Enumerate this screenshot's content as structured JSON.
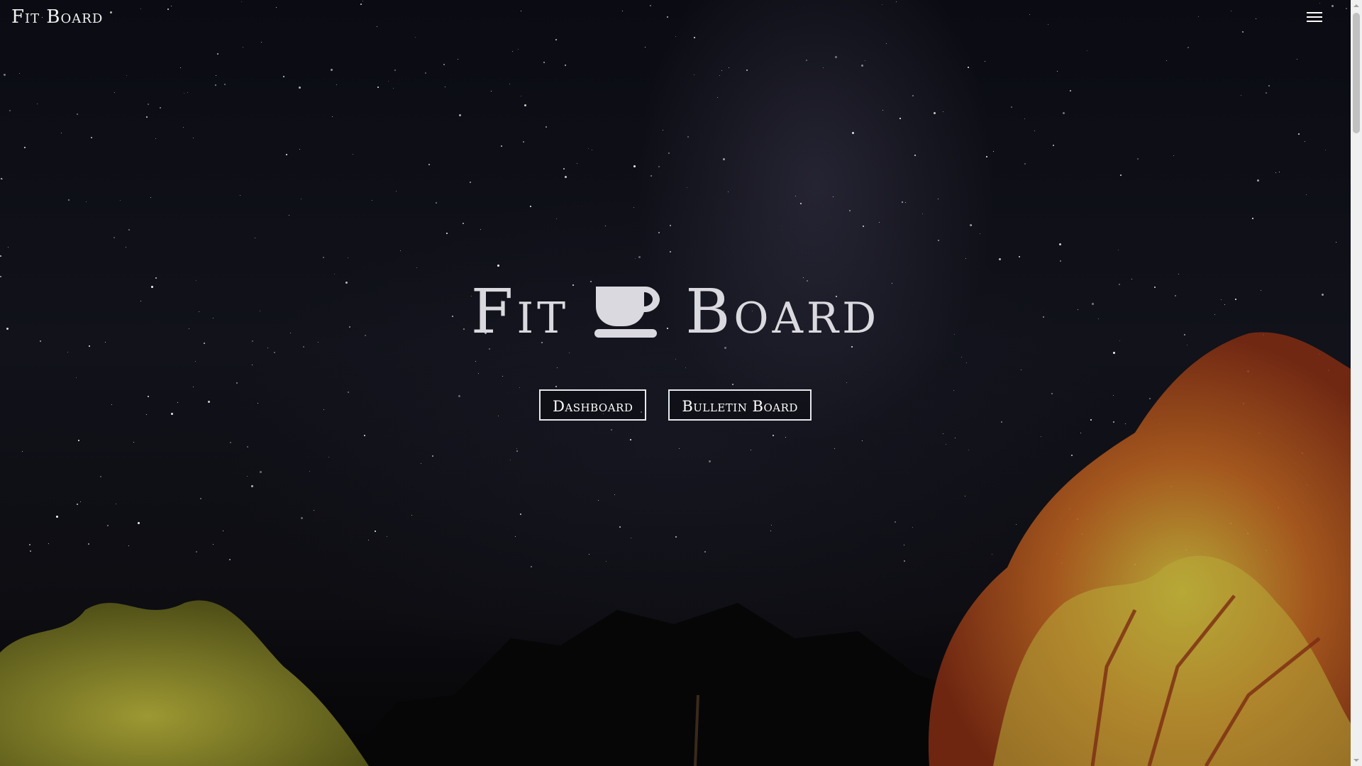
{
  "navbar": {
    "brand": "Fit Board",
    "menu_icon": "hamburger-menu-icon"
  },
  "hero": {
    "title_left": "Fit",
    "title_icon": "coffee-cup-icon",
    "title_right": "Board",
    "buttons": [
      {
        "label": "Dashboard"
      },
      {
        "label": "Bulletin Board"
      }
    ]
  },
  "scrollbar": {
    "up_icon": "scroll-up-arrow-icon",
    "down_icon": "scroll-down-arrow-icon"
  }
}
